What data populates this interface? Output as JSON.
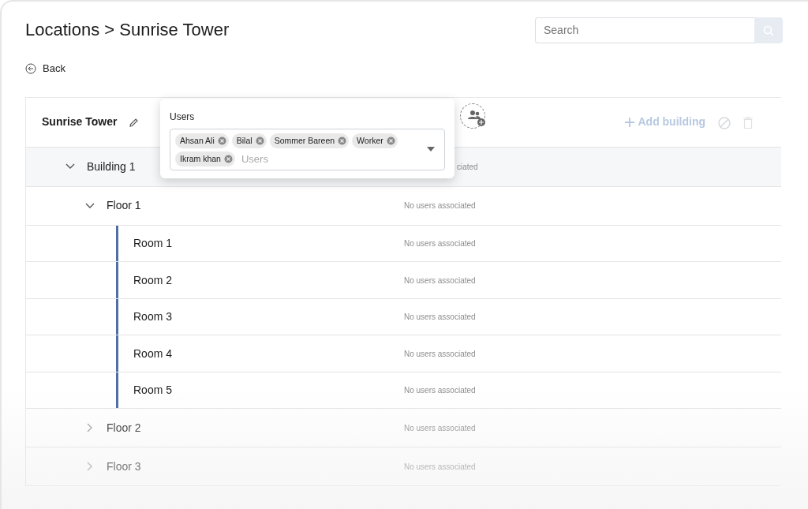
{
  "title": "Locations > Sunrise Tower",
  "search": {
    "placeholder": "Search"
  },
  "back": "Back",
  "location": {
    "name": "Sunrise Tower",
    "add_label": "Add building"
  },
  "buildings": [
    {
      "name": "Building 1",
      "expanded": true,
      "users_note": "ciated",
      "children": [
        {
          "name": "Floor 1",
          "expanded": true,
          "users_note": "No users associated",
          "children": [
            {
              "name": "Room 1",
              "users_note": "No users associated"
            },
            {
              "name": "Room 2",
              "users_note": "No users associated"
            },
            {
              "name": "Room 3",
              "users_note": "No users associated"
            },
            {
              "name": "Room 4",
              "users_note": "No users associated"
            },
            {
              "name": "Room 5",
              "users_note": "No users associated"
            }
          ]
        },
        {
          "name": "Floor 2",
          "expanded": false,
          "users_note": "No users associated"
        },
        {
          "name": "Floor 3",
          "expanded": false,
          "users_note": "No users associated"
        }
      ]
    }
  ],
  "users_popover": {
    "label": "Users",
    "placeholder": "Users",
    "selected_users": [
      "Ahsan Ali",
      "Bilal",
      "Sommer Bareen",
      "Worker",
      "Ikram khan"
    ]
  }
}
